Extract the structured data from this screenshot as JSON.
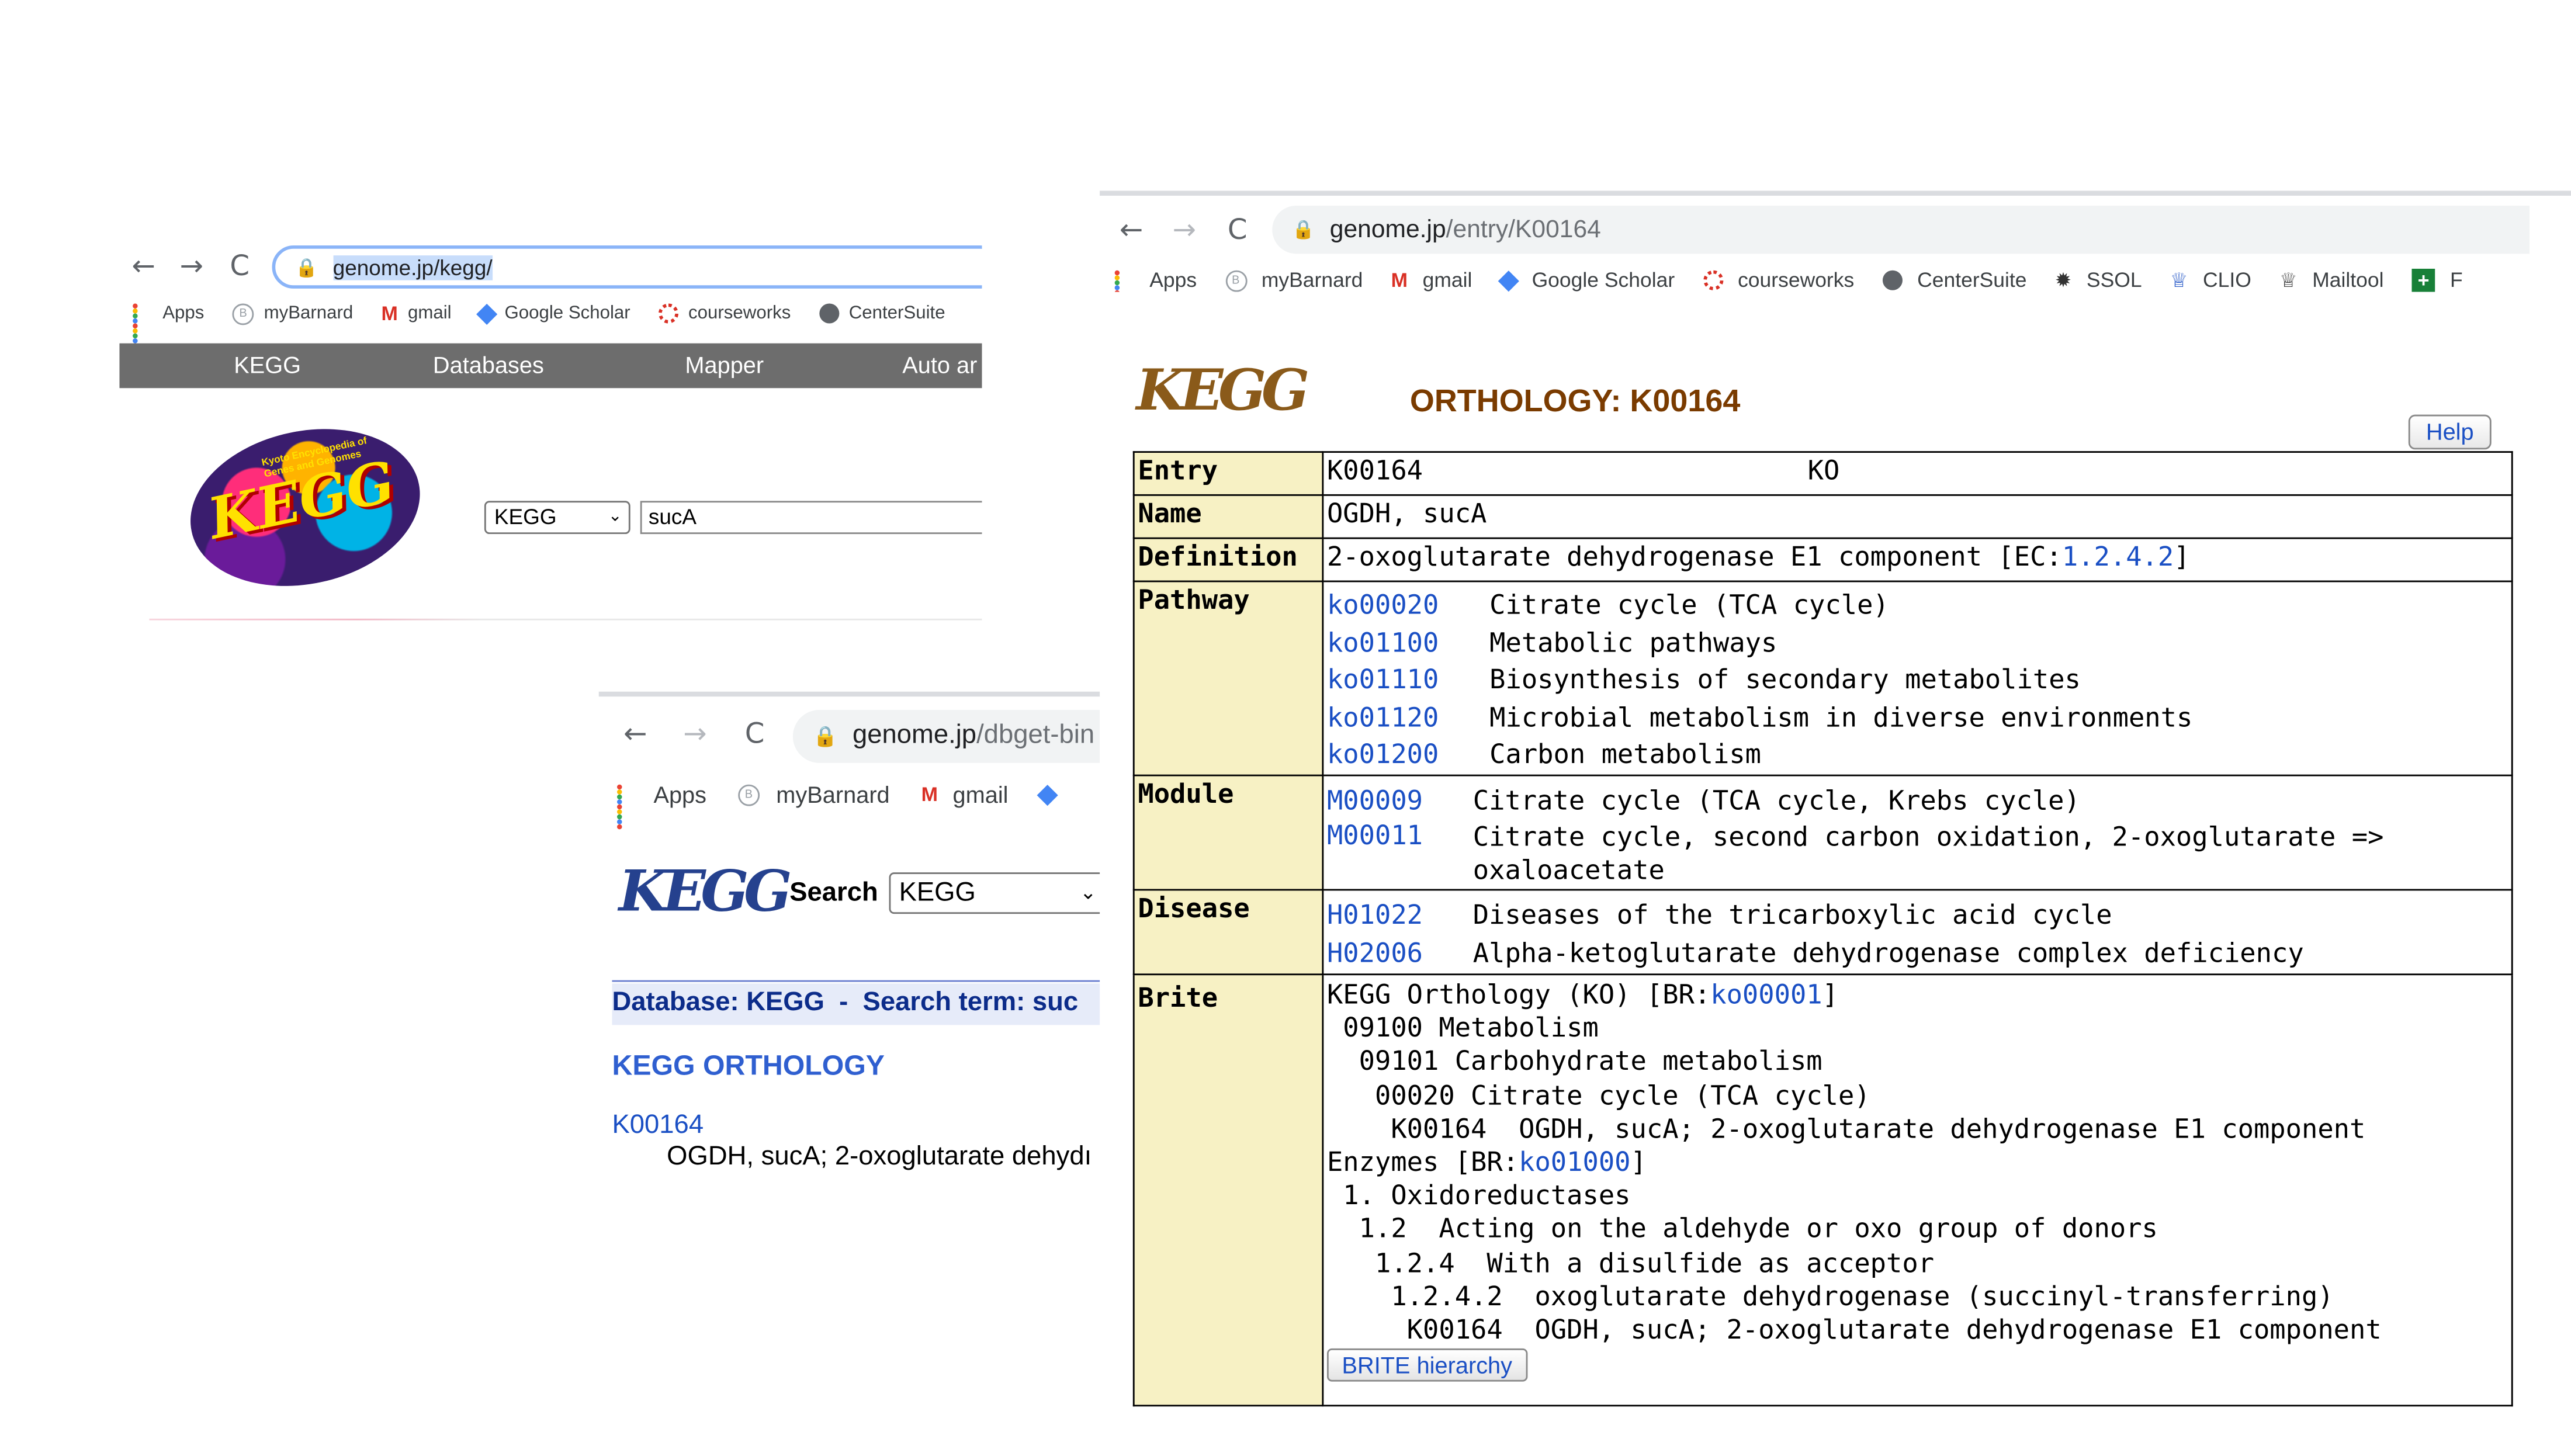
{
  "win1": {
    "nav": {
      "back": "←",
      "forward": "→",
      "reload": "C"
    },
    "url": "genome.jp/kegg/",
    "bookmarks": [
      "Apps",
      "myBarnard",
      "gmail",
      "Google Scholar",
      "courseworks",
      "CenterSuite"
    ],
    "menu": [
      "KEGG",
      "Databases",
      "Mapper",
      "Auto ar"
    ],
    "logo_text": "KEGG",
    "logo_caption": "Kyoto Encyclopedia of Genes and Genomes",
    "db_select": "KEGG",
    "search_value": "sucA"
  },
  "win2": {
    "nav": {
      "back": "←",
      "forward": "→",
      "reload": "C"
    },
    "url_host": "genome.jp",
    "url_path": "/dbget-bin",
    "bookmarks": [
      "Apps",
      "myBarnard",
      "gmail"
    ],
    "logo_text": "KEGG",
    "search_label": "Search",
    "db_select": "KEGG",
    "results_header": "Database: KEGG  -  Search term: suc",
    "section_title": "KEGG ORTHOLOGY",
    "result_id": "K00164",
    "result_desc": "OGDH, sucA; 2-oxoglutarate dehydı"
  },
  "win3": {
    "nav": {
      "back": "←",
      "forward": "→",
      "reload": "C"
    },
    "url_host": "genome.jp",
    "url_path": "/entry/K00164",
    "bookmarks": [
      "Apps",
      "myBarnard",
      "gmail",
      "Google Scholar",
      "courseworks",
      "CenterSuite",
      "SSOL",
      "CLIO",
      "Mailtool",
      "F"
    ],
    "logo_text": "KEGG",
    "title": "ORTHOLOGY: K00164",
    "help_label": "Help",
    "entry": {
      "label": "Entry",
      "id": "K00164",
      "type": "KO"
    },
    "name": {
      "label": "Name",
      "value": "OGDH, sucA"
    },
    "definition": {
      "label": "Definition",
      "text": "2-oxoglutarate dehydrogenase E1 component [EC:",
      "ec": "1.2.4.2",
      "close": "]"
    },
    "pathway": {
      "label": "Pathway",
      "items": [
        {
          "id": "ko00020",
          "desc": "Citrate cycle (TCA cycle)"
        },
        {
          "id": "ko01100",
          "desc": "Metabolic pathways"
        },
        {
          "id": "ko01110",
          "desc": "Biosynthesis of secondary metabolites"
        },
        {
          "id": "ko01120",
          "desc": "Microbial metabolism in diverse environments"
        },
        {
          "id": "ko01200",
          "desc": "Carbon metabolism"
        }
      ]
    },
    "module": {
      "label": "Module",
      "items": [
        {
          "id": "M00009",
          "desc": "Citrate cycle (TCA cycle, Krebs cycle)"
        },
        {
          "id": "M00011",
          "desc": "Citrate cycle, second carbon oxidation, 2-oxoglutarate => oxaloacetate"
        }
      ]
    },
    "disease": {
      "label": "Disease",
      "items": [
        {
          "id": "H01022",
          "desc": "Diseases of the tricarboxylic acid cycle"
        },
        {
          "id": "H02006",
          "desc": "Alpha-ketoglutarate dehydrogenase complex deficiency"
        }
      ]
    },
    "brite": {
      "label": "Brite",
      "l1_pre": "KEGG Orthology (KO) [BR:",
      "l1_link": "ko00001",
      "l1_post": "]",
      "l2": " 09100 Metabolism",
      "l3": "  09101 Carbohydrate metabolism",
      "l4": "   00020 Citrate cycle (TCA cycle)",
      "l5": "    K00164  OGDH, sucA; 2-oxoglutarate dehydrogenase E1 component",
      "l6_pre": "Enzymes [BR:",
      "l6_link": "ko01000",
      "l6_post": "]",
      "l7": " 1. Oxidoreductases",
      "l8": "  1.2  Acting on the aldehyde or oxo group of donors",
      "l9": "   1.2.4  With a disulfide as acceptor",
      "l10": "    1.2.4.2  oxoglutarate dehydrogenase (succinyl-transferring)",
      "l11": "     K00164  OGDH, sucA; 2-oxoglutarate dehydrogenase E1 component",
      "button": "BRITE hierarchy"
    }
  }
}
